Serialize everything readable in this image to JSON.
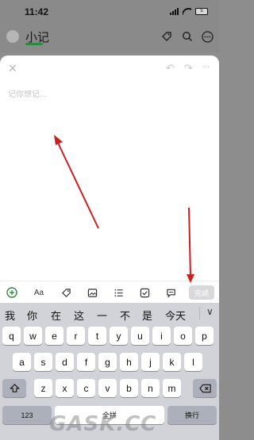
{
  "status_bar": {
    "time": "11:42",
    "battery": "5"
  },
  "header": {
    "title": "小记"
  },
  "editor": {
    "placeholder": "记你想记...",
    "done_label": "完成",
    "text_format_label": "Aa"
  },
  "keyboard": {
    "candidates": [
      "我",
      "你",
      "在",
      "这",
      "一",
      "不",
      "是",
      "今天"
    ],
    "row1": [
      "q",
      "w",
      "e",
      "r",
      "t",
      "y",
      "u",
      "i",
      "o",
      "p"
    ],
    "row2": [
      "a",
      "s",
      "d",
      "f",
      "g",
      "h",
      "j",
      "k",
      "l"
    ],
    "row3": [
      "z",
      "x",
      "c",
      "v",
      "b",
      "n",
      "m"
    ],
    "num_label": "123",
    "space_label": "全拼",
    "return_label": "换行"
  },
  "watermark": "GASK.CC",
  "colors": {
    "accent_green": "#2e8b3e",
    "annotation_red": "#cc1f1f",
    "keyboard_bg": "#d1d3d9"
  },
  "icons": {
    "toolbar": [
      "plus-circle-icon",
      "text-format-icon",
      "tag-icon",
      "image-icon",
      "list-icon",
      "checkbox-icon",
      "comment-icon"
    ],
    "header": [
      "tag-icon",
      "search-icon",
      "more-icon"
    ]
  }
}
